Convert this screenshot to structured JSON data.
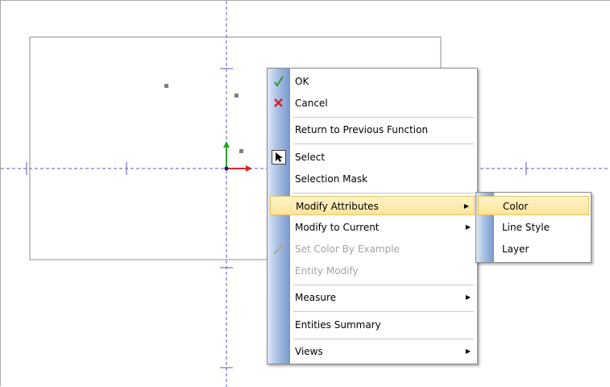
{
  "context_menu": {
    "items": [
      {
        "label": "OK",
        "icon": "checkmark-icon",
        "enabled": true
      },
      {
        "label": "Cancel",
        "icon": "red-x-icon",
        "enabled": true
      },
      {
        "label": "Return to Previous Function",
        "enabled": true
      },
      {
        "label": "Select",
        "icon": "arrow-cursor-icon",
        "enabled": true
      },
      {
        "label": "Selection Mask",
        "enabled": true
      },
      {
        "label": "Modify Attributes",
        "enabled": true,
        "submenu": true,
        "highlighted": true
      },
      {
        "label": "Modify to Current",
        "enabled": true,
        "submenu": true
      },
      {
        "label": "Set Color By Example",
        "icon": "eyedropper-icon",
        "enabled": false
      },
      {
        "label": "Entity Modify",
        "enabled": false
      },
      {
        "label": "Measure",
        "enabled": true,
        "submenu": true
      },
      {
        "label": "Entities Summary",
        "enabled": true
      },
      {
        "label": "Views",
        "enabled": true,
        "submenu": true
      }
    ]
  },
  "submenu": {
    "parent": "Modify Attributes",
    "items": [
      {
        "label": "Color",
        "highlighted": true
      },
      {
        "label": "Line Style"
      },
      {
        "label": "Layer"
      }
    ]
  },
  "colors": {
    "axis_dash": "#5a5ac8",
    "axis_x_arrow": "#d42a2a",
    "axis_y_arrow": "#2aa02a",
    "highlight_bg": "#fbe49a",
    "highlight_border": "#e7c462",
    "gutter_blue": "#7898cc"
  },
  "icons": {
    "submenu_arrow": "▶"
  }
}
